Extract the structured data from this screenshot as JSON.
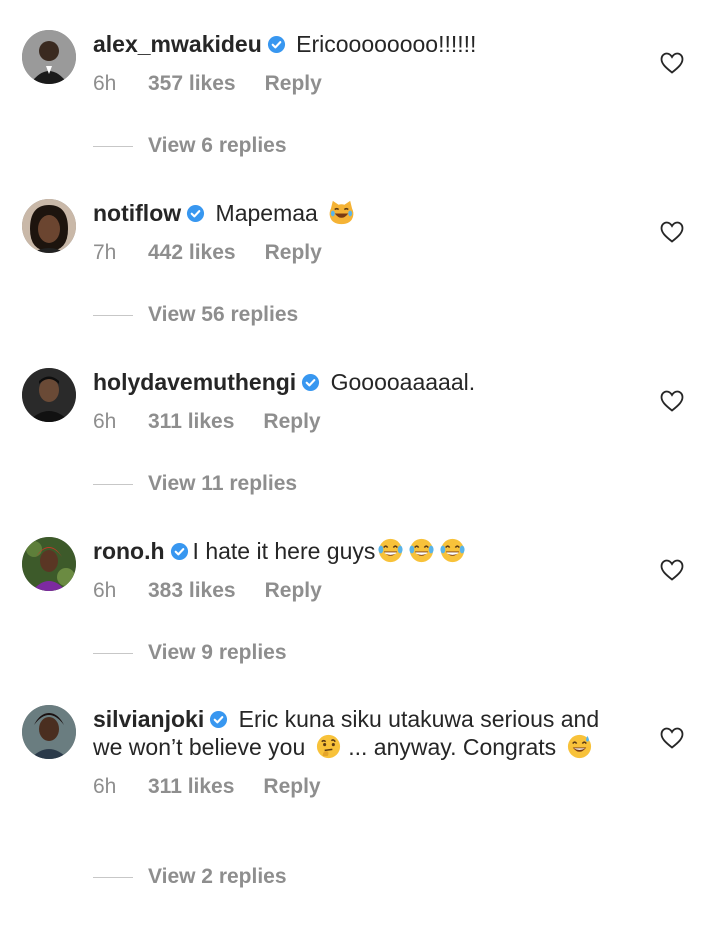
{
  "comments": [
    {
      "username": "alex_mwakideu",
      "text": "Ericoooooooo!!!!!!",
      "time": "6h",
      "likes": "357 likes",
      "reply": "Reply",
      "view_replies": "View 6 replies",
      "emojis": []
    },
    {
      "username": "notiflow",
      "text": "Mapemaa",
      "time": "7h",
      "likes": "442 likes",
      "reply": "Reply",
      "view_replies": "View 56 replies",
      "emojis": [
        "joy-cat"
      ]
    },
    {
      "username": "holydavemuthengi",
      "text": "Gooooaaaaal.",
      "time": "6h",
      "likes": "311 likes",
      "reply": "Reply",
      "view_replies": "View 11 replies",
      "emojis": []
    },
    {
      "username": "rono.h",
      "text": "I hate it here guys",
      "time": "6h",
      "likes": "383 likes",
      "reply": "Reply",
      "view_replies": "View 9 replies",
      "emojis": [
        "joy",
        "joy",
        "joy"
      ]
    },
    {
      "username": "silvianjoki",
      "text_part1": "Eric kuna siku utakuwa serious and we won’t believe you",
      "text_part2": "... anyway. Congrats",
      "time": "6h",
      "likes": "311 likes",
      "reply": "Reply",
      "view_replies": "View 2 replies",
      "emojis": [
        "thinking",
        "sweat-smile"
      ]
    }
  ],
  "colors": {
    "text": "#262626",
    "meta": "#8e8e8e",
    "verified": "#3897f0"
  }
}
